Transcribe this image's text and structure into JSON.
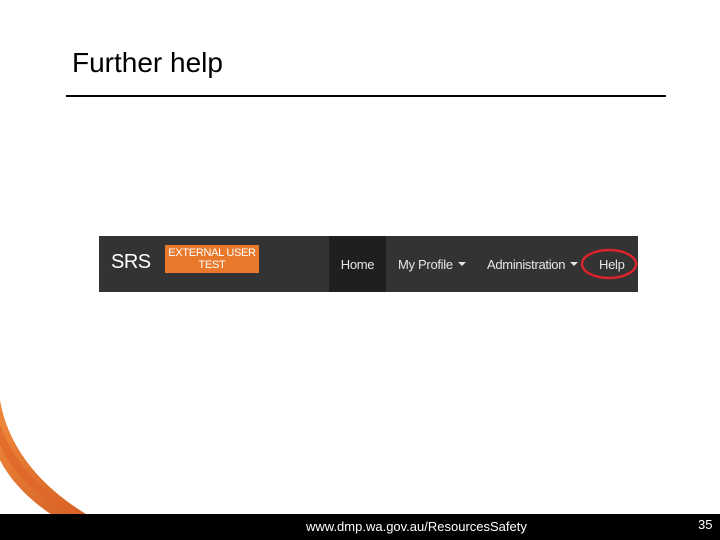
{
  "slide": {
    "title": "Further help"
  },
  "navbar": {
    "brand": "SRS",
    "badge_line1": "EXTERNAL USER",
    "badge_line2": "TEST",
    "items": [
      {
        "label": "Home",
        "active": true,
        "dropdown": false
      },
      {
        "label": "My Profile",
        "active": false,
        "dropdown": true
      },
      {
        "label": "Administration",
        "active": false,
        "dropdown": true
      },
      {
        "label": "Help",
        "active": false,
        "dropdown": false,
        "highlighted": true
      }
    ],
    "colors": {
      "background": "#333333",
      "active_item": "#1f1f1f",
      "badge": "#e8782a",
      "highlight_ring": "#d9232d"
    }
  },
  "footer": {
    "url": "www.dmp.wa.gov.au/ResourcesSafety",
    "page_number": "35"
  },
  "theme": {
    "accent": "#e0662a"
  }
}
